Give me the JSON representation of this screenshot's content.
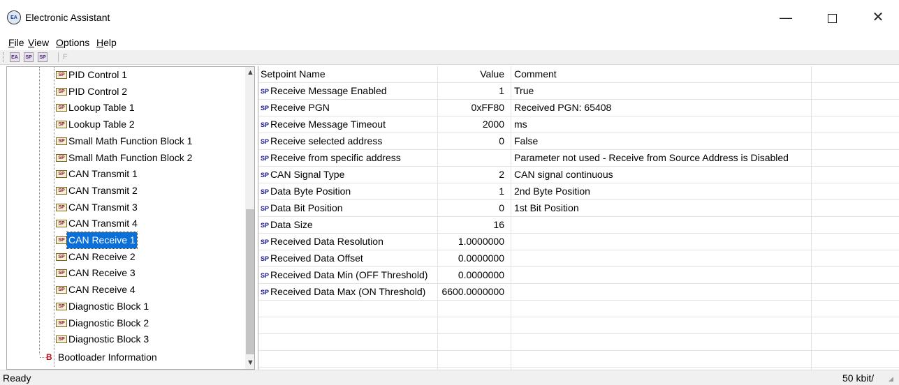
{
  "window": {
    "title": "Electronic Assistant",
    "app_icon_text": "EA",
    "minimize_glyph": "—",
    "close_glyph": "✕"
  },
  "menu": {
    "items": [
      {
        "label": "File"
      },
      {
        "label": "View"
      },
      {
        "label": "Options"
      },
      {
        "label": "Help"
      }
    ]
  },
  "toolbar": {
    "buttons": [
      {
        "icon": "connect-icon",
        "text": "EA"
      },
      {
        "icon": "read-icon",
        "text": "SP"
      },
      {
        "icon": "write-icon",
        "text": "SP"
      }
    ],
    "f_label": "F"
  },
  "tree": {
    "items": [
      {
        "label": "PID Control 1",
        "badge": "SP"
      },
      {
        "label": "PID Control 2",
        "badge": "SP"
      },
      {
        "label": "Lookup Table 1",
        "badge": "SP"
      },
      {
        "label": "Lookup Table 2",
        "badge": "SP"
      },
      {
        "label": "Small Math Function Block 1",
        "badge": "SP"
      },
      {
        "label": "Small Math Function Block 2",
        "badge": "SP"
      },
      {
        "label": "CAN Transmit 1",
        "badge": "SP"
      },
      {
        "label": "CAN Transmit 2",
        "badge": "SP"
      },
      {
        "label": "CAN Transmit 3",
        "badge": "SP"
      },
      {
        "label": "CAN Transmit 4",
        "badge": "SP"
      },
      {
        "label": "CAN Receive 1",
        "badge": "SP",
        "selected": true
      },
      {
        "label": "CAN Receive 2",
        "badge": "SP"
      },
      {
        "label": "CAN Receive 3",
        "badge": "SP"
      },
      {
        "label": "CAN Receive 4",
        "badge": "SP"
      },
      {
        "label": "Diagnostic Block 1",
        "badge": "SP"
      },
      {
        "label": "Diagnostic Block 2",
        "badge": "SP"
      },
      {
        "label": "Diagnostic Block 3",
        "badge": "SP"
      }
    ],
    "bootloader": {
      "badge": "B",
      "label": "Bootloader Information"
    },
    "scroll_up": "▲",
    "scroll_down": "▼"
  },
  "grid": {
    "headers": {
      "name": "Setpoint Name",
      "value": "Value",
      "comment": "Comment"
    },
    "sp_tag": "SP",
    "rows": [
      {
        "name": "Receive Message Enabled",
        "value": "1",
        "comment": "True"
      },
      {
        "name": "Receive PGN",
        "value": "0xFF80",
        "comment": "Received PGN: 65408"
      },
      {
        "name": "Receive Message Timeout",
        "value": "2000",
        "comment": "ms"
      },
      {
        "name": "Receive selected address",
        "value": "0",
        "comment": "False"
      },
      {
        "name": "Receive from specific address",
        "value": "",
        "comment": "Parameter not used - Receive from Source Address is Disabled"
      },
      {
        "name": "CAN Signal Type",
        "value": "2",
        "comment": "CAN signal continuous"
      },
      {
        "name": "Data Byte Position",
        "value": "1",
        "comment": "2nd Byte Position"
      },
      {
        "name": "Data Bit Position",
        "value": "0",
        "comment": "1st Bit Position"
      },
      {
        "name": "Data Size",
        "value": "16",
        "comment": ""
      },
      {
        "name": "Received Data Resolution",
        "value": "1.0000000",
        "comment": ""
      },
      {
        "name": "Received Data Offset",
        "value": "0.0000000",
        "comment": ""
      },
      {
        "name": "Received Data Min (OFF Threshold)",
        "value": "0.0000000",
        "comment": ""
      },
      {
        "name": "Received Data Max (ON Threshold)",
        "value": "6600.0000000",
        "comment": ""
      }
    ]
  },
  "status": {
    "text": "Ready",
    "right_text": "50 kbit/"
  }
}
